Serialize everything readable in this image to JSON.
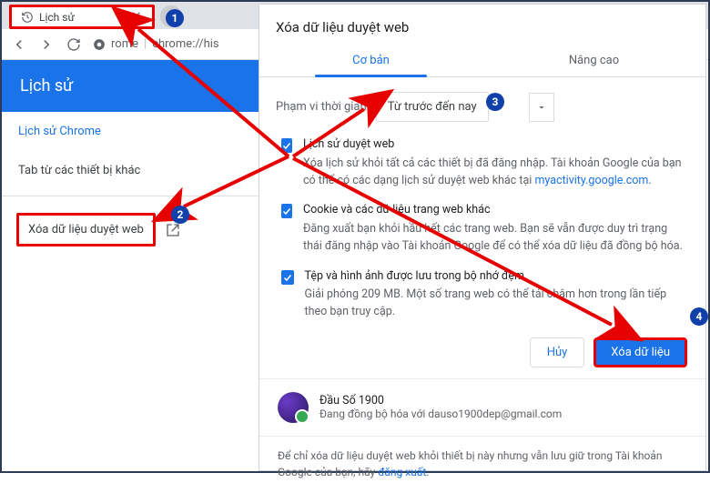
{
  "browser": {
    "tab_title": "Lịch sử",
    "url_prefix": "rome",
    "url_rest": "chrome://his"
  },
  "history_page": {
    "heading": "Lịch sử",
    "item_chrome": "Lịch sử Chrome",
    "item_tabs": "Tab từ các thiết bị khác",
    "clear_data": "Xóa dữ liệu duyệt web"
  },
  "dialog": {
    "title": "Xóa dữ liệu duyệt web",
    "tab_basic": "Cơ bản",
    "tab_advanced": "Nâng cao",
    "range_label": "Phạm vi thời gian",
    "range_value": "Từ trước đến nay",
    "opt1_head": "Lịch sử duyệt web",
    "opt1_body_a": "Xóa lịch sử khỏi tất cả các thiết bị đã đăng nhập. Tài khoản Google của bạn có thể có các dạng lịch sử duyệt web khác tại ",
    "opt1_link": "myactivity.google.com",
    "opt1_body_b": ".",
    "opt2_head": "Cookie và các dữ liệu trang web khác",
    "opt2_body": "Đăng xuất bạn khỏi hầu hết các trang web. Bạn sẽ vẫn được duy trì trạng thái đăng nhập vào Tài khoản Google để có thể xóa dữ liệu đã đồng bộ hóa.",
    "opt3_head": "Tệp và hình ảnh được lưu trong bộ nhớ đệm",
    "opt3_body": "Giải phóng 209 MB. Một số trang web có thể tải chậm hơn trong lần tiếp theo bạn truy cập.",
    "btn_cancel": "Hủy",
    "btn_clear": "Xóa dữ liệu",
    "account_name": "Đầu Số 1900",
    "account_sync": "Đang đồng bộ hóa với dauso1900dep@gmail.com",
    "footer_a": "Để chỉ xóa dữ liệu duyệt web khỏi thiết bị này nhưng vẫn lưu giữ trong Tài khoản Google của bạn, hãy ",
    "footer_link": "đăng xuất",
    "footer_b": "."
  },
  "badges": {
    "b1": "1",
    "b2": "2",
    "b3": "3",
    "b4": "4"
  }
}
